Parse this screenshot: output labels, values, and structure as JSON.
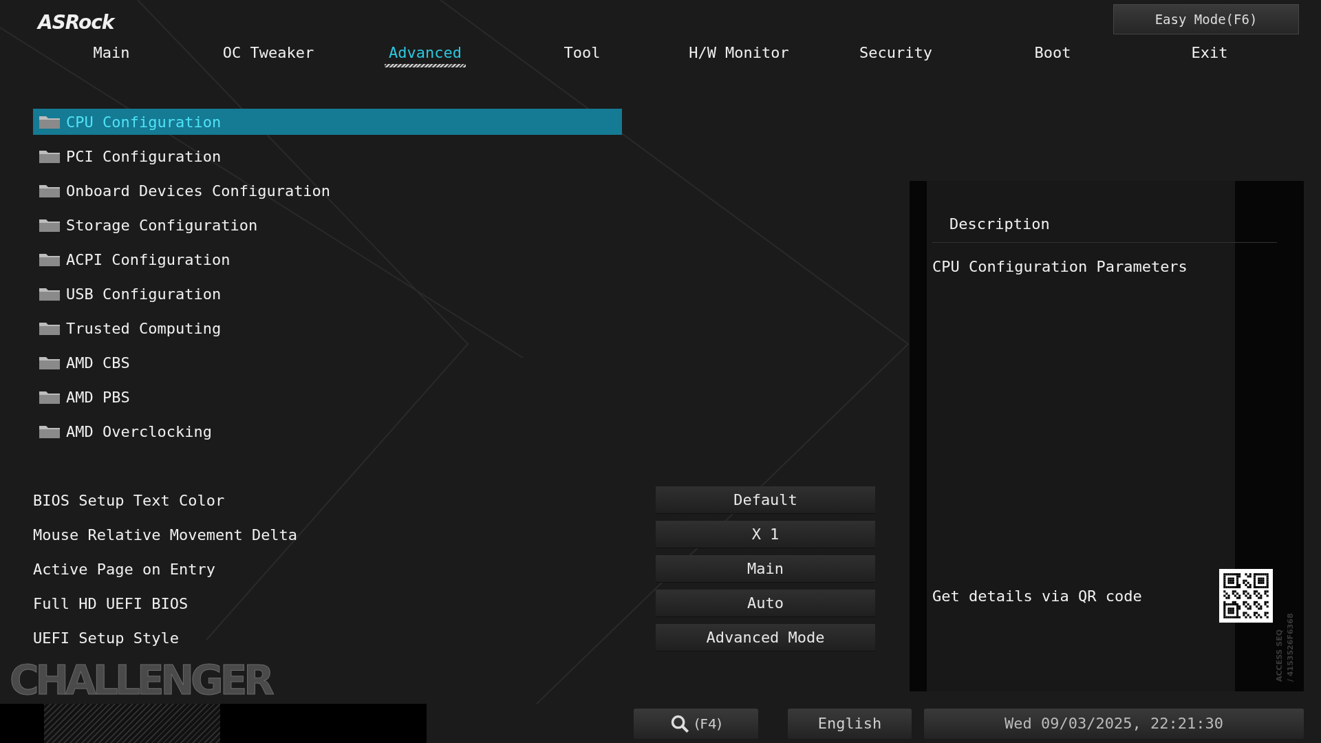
{
  "logo": "ASRock",
  "easy_mode_button": "Easy Mode(F6)",
  "tabs": [
    {
      "label": "Main",
      "selected": false
    },
    {
      "label": "OC Tweaker",
      "selected": false
    },
    {
      "label": "Advanced",
      "selected": true
    },
    {
      "label": "Tool",
      "selected": false
    },
    {
      "label": "H/W Monitor",
      "selected": false
    },
    {
      "label": "Security",
      "selected": false
    },
    {
      "label": "Boot",
      "selected": false
    },
    {
      "label": "Exit",
      "selected": false
    }
  ],
  "menu": [
    {
      "label": "CPU Configuration",
      "selected": true
    },
    {
      "label": "PCI Configuration",
      "selected": false
    },
    {
      "label": "Onboard Devices Configuration",
      "selected": false
    },
    {
      "label": "Storage Configuration",
      "selected": false
    },
    {
      "label": "ACPI Configuration",
      "selected": false
    },
    {
      "label": "USB Configuration",
      "selected": false
    },
    {
      "label": "Trusted Computing",
      "selected": false
    },
    {
      "label": "AMD CBS",
      "selected": false
    },
    {
      "label": "AMD PBS",
      "selected": false
    },
    {
      "label": "AMD Overclocking",
      "selected": false
    }
  ],
  "settings": [
    {
      "label": "BIOS Setup Text Color",
      "value": "Default"
    },
    {
      "label": "Mouse Relative Movement Delta",
      "value": "X 1"
    },
    {
      "label": "Active Page on Entry",
      "value": "Main"
    },
    {
      "label": "Full HD UEFI BIOS",
      "value": "Auto"
    },
    {
      "label": "UEFI Setup Style",
      "value": "Advanced Mode"
    }
  ],
  "description": {
    "title": "Description",
    "text": "CPU Configuration Parameters",
    "qr_hint": "Get details via QR code"
  },
  "access_seq": [
    "ACCESS SEQ",
    "/ 4153526F6368"
  ],
  "brand_mark": "CHALLENGER",
  "footer": {
    "search": "(F4)",
    "language": "English",
    "datetime": "Wed 09/03/2025, 22:21:30"
  }
}
